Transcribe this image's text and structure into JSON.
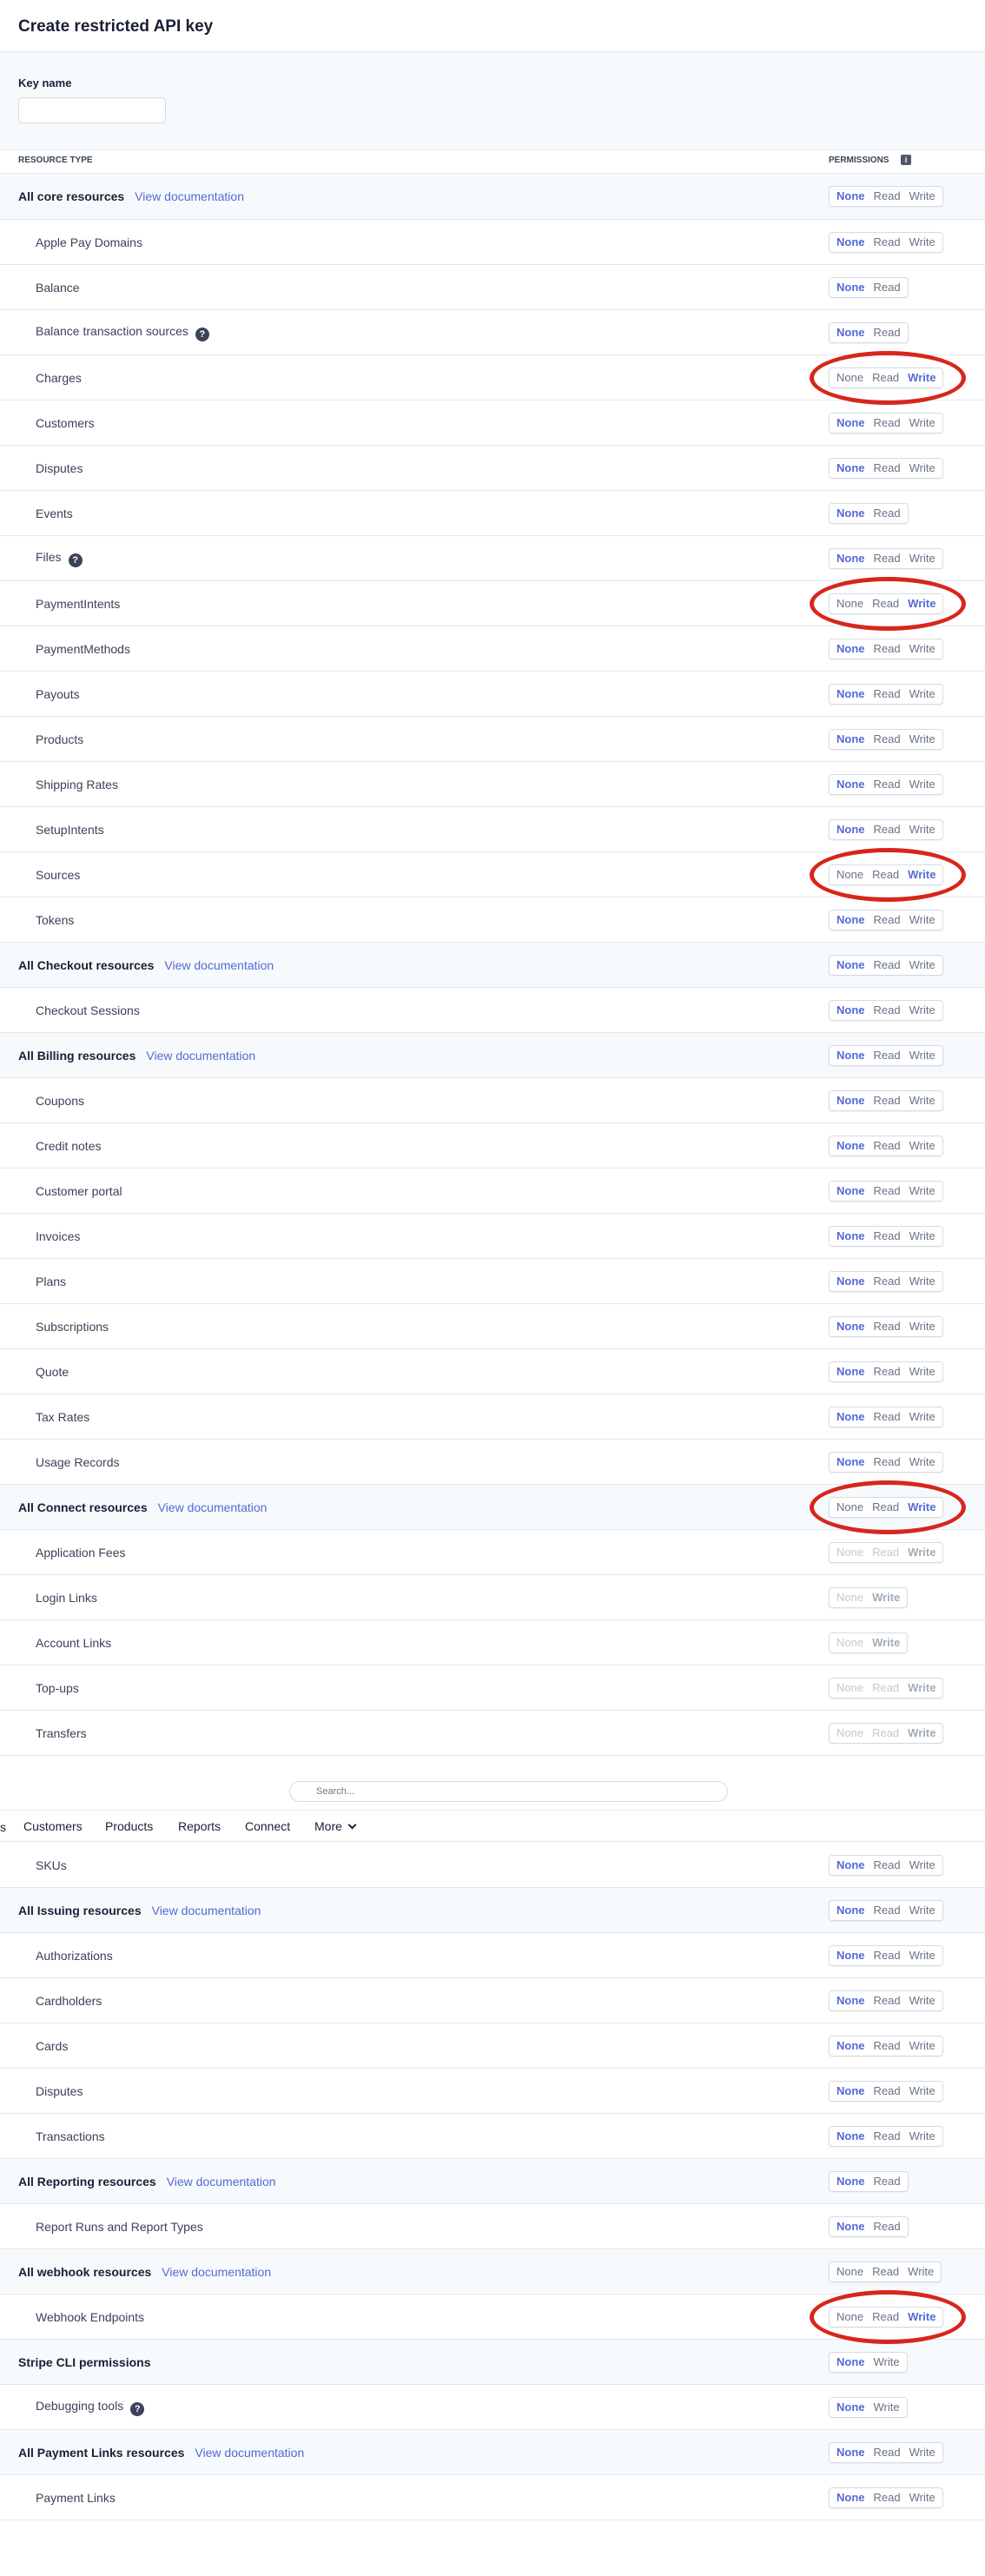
{
  "page": {
    "title": "Create restricted API key",
    "key_name_label": "Key name",
    "key_name_value": "",
    "col_resource": "RESOURCE TYPE",
    "col_permissions": "PERMISSIONS",
    "info_glyph": "i"
  },
  "options": {
    "none": "None",
    "read": "Read",
    "write": "Write"
  },
  "rows": [
    {
      "name": "All core resources",
      "type": "parent",
      "doc": "View documentation",
      "opts": [
        "none",
        "read",
        "write"
      ],
      "sel": "none"
    },
    {
      "name": "Apple Pay Domains",
      "type": "child",
      "opts": [
        "none",
        "read",
        "write"
      ],
      "sel": "none"
    },
    {
      "name": "Balance",
      "type": "child",
      "opts": [
        "none",
        "read"
      ],
      "sel": "none"
    },
    {
      "name": "Balance transaction sources",
      "type": "child",
      "help": true,
      "opts": [
        "none",
        "read"
      ],
      "sel": "none"
    },
    {
      "name": "Charges",
      "type": "child",
      "opts": [
        "none",
        "read",
        "write"
      ],
      "sel": "write",
      "circled": true
    },
    {
      "name": "Customers",
      "type": "child",
      "opts": [
        "none",
        "read",
        "write"
      ],
      "sel": "none"
    },
    {
      "name": "Disputes",
      "type": "child",
      "opts": [
        "none",
        "read",
        "write"
      ],
      "sel": "none"
    },
    {
      "name": "Events",
      "type": "child",
      "opts": [
        "none",
        "read"
      ],
      "sel": "none"
    },
    {
      "name": "Files",
      "type": "child",
      "help": true,
      "opts": [
        "none",
        "read",
        "write"
      ],
      "sel": "none"
    },
    {
      "name": "PaymentIntents",
      "type": "child",
      "opts": [
        "none",
        "read",
        "write"
      ],
      "sel": "write",
      "circled": true
    },
    {
      "name": "PaymentMethods",
      "type": "child",
      "opts": [
        "none",
        "read",
        "write"
      ],
      "sel": "none"
    },
    {
      "name": "Payouts",
      "type": "child",
      "opts": [
        "none",
        "read",
        "write"
      ],
      "sel": "none"
    },
    {
      "name": "Products",
      "type": "child",
      "opts": [
        "none",
        "read",
        "write"
      ],
      "sel": "none"
    },
    {
      "name": "Shipping Rates",
      "type": "child",
      "opts": [
        "none",
        "read",
        "write"
      ],
      "sel": "none"
    },
    {
      "name": "SetupIntents",
      "type": "child",
      "opts": [
        "none",
        "read",
        "write"
      ],
      "sel": "none"
    },
    {
      "name": "Sources",
      "type": "child",
      "opts": [
        "none",
        "read",
        "write"
      ],
      "sel": "write",
      "circled": true
    },
    {
      "name": "Tokens",
      "type": "child",
      "opts": [
        "none",
        "read",
        "write"
      ],
      "sel": "none"
    },
    {
      "name": "All Checkout resources",
      "type": "parent",
      "doc": "View documentation",
      "opts": [
        "none",
        "read",
        "write"
      ],
      "sel": "none"
    },
    {
      "name": "Checkout Sessions",
      "type": "child",
      "opts": [
        "none",
        "read",
        "write"
      ],
      "sel": "none"
    },
    {
      "name": "All Billing resources",
      "type": "parent",
      "doc": "View documentation",
      "opts": [
        "none",
        "read",
        "write"
      ],
      "sel": "none"
    },
    {
      "name": "Coupons",
      "type": "child",
      "opts": [
        "none",
        "read",
        "write"
      ],
      "sel": "none"
    },
    {
      "name": "Credit notes",
      "type": "child",
      "opts": [
        "none",
        "read",
        "write"
      ],
      "sel": "none"
    },
    {
      "name": "Customer portal",
      "type": "child",
      "opts": [
        "none",
        "read",
        "write"
      ],
      "sel": "none"
    },
    {
      "name": "Invoices",
      "type": "child",
      "opts": [
        "none",
        "read",
        "write"
      ],
      "sel": "none"
    },
    {
      "name": "Plans",
      "type": "child",
      "opts": [
        "none",
        "read",
        "write"
      ],
      "sel": "none"
    },
    {
      "name": "Subscriptions",
      "type": "child",
      "opts": [
        "none",
        "read",
        "write"
      ],
      "sel": "none"
    },
    {
      "name": "Quote",
      "type": "child",
      "opts": [
        "none",
        "read",
        "write"
      ],
      "sel": "none"
    },
    {
      "name": "Tax Rates",
      "type": "child",
      "opts": [
        "none",
        "read",
        "write"
      ],
      "sel": "none"
    },
    {
      "name": "Usage Records",
      "type": "child",
      "opts": [
        "none",
        "read",
        "write"
      ],
      "sel": "none"
    },
    {
      "name": "All Connect resources",
      "type": "parent",
      "doc": "View documentation",
      "opts": [
        "none",
        "read",
        "write"
      ],
      "sel": "write",
      "circled": true
    },
    {
      "name": "Application Fees",
      "type": "child",
      "opts": [
        "none",
        "read",
        "write"
      ],
      "sel": "write",
      "disabled": true
    },
    {
      "name": "Login Links",
      "type": "child",
      "opts": [
        "none",
        "write"
      ],
      "sel": "write",
      "disabled": true
    },
    {
      "name": "Account Links",
      "type": "child",
      "opts": [
        "none",
        "write"
      ],
      "sel": "write",
      "disabled": true
    },
    {
      "name": "Top-ups",
      "type": "child",
      "opts": [
        "none",
        "read",
        "write"
      ],
      "sel": "write",
      "disabled": true
    },
    {
      "name": "Transfers",
      "type": "child",
      "opts": [
        "none",
        "read",
        "write"
      ],
      "sel": "write",
      "disabled": true
    }
  ],
  "nav": {
    "search_placeholder": "Search...",
    "cut_item": "s",
    "items": [
      "Customers",
      "Products",
      "Reports",
      "Connect",
      "More"
    ]
  },
  "rows2": [
    {
      "name": "SKUs",
      "type": "child",
      "opts": [
        "none",
        "read",
        "write"
      ],
      "sel": "none"
    },
    {
      "name": "All Issuing resources",
      "type": "parent",
      "doc": "View documentation",
      "opts": [
        "none",
        "read",
        "write"
      ],
      "sel": "none"
    },
    {
      "name": "Authorizations",
      "type": "child",
      "opts": [
        "none",
        "read",
        "write"
      ],
      "sel": "none"
    },
    {
      "name": "Cardholders",
      "type": "child",
      "opts": [
        "none",
        "read",
        "write"
      ],
      "sel": "none"
    },
    {
      "name": "Cards",
      "type": "child",
      "opts": [
        "none",
        "read",
        "write"
      ],
      "sel": "none"
    },
    {
      "name": "Disputes",
      "type": "child",
      "opts": [
        "none",
        "read",
        "write"
      ],
      "sel": "none"
    },
    {
      "name": "Transactions",
      "type": "child",
      "opts": [
        "none",
        "read",
        "write"
      ],
      "sel": "none"
    },
    {
      "name": "All Reporting resources",
      "type": "parent",
      "doc": "View documentation",
      "opts": [
        "none",
        "read"
      ],
      "sel": "none"
    },
    {
      "name": "Report Runs and Report Types",
      "type": "child",
      "opts": [
        "none",
        "read"
      ],
      "sel": "none"
    },
    {
      "name": "All webhook resources",
      "type": "parent",
      "doc": "View documentation",
      "opts": [
        "none",
        "read",
        "write"
      ],
      "sel": "mixed"
    },
    {
      "name": "Webhook Endpoints",
      "type": "child",
      "opts": [
        "none",
        "read",
        "write"
      ],
      "sel": "write",
      "circled": true
    },
    {
      "name": "Stripe CLI permissions",
      "type": "parent",
      "opts": [
        "none",
        "write"
      ],
      "sel": "none"
    },
    {
      "name": "Debugging tools",
      "type": "child",
      "help": true,
      "opts": [
        "none",
        "write"
      ],
      "sel": "none"
    },
    {
      "name": "All Payment Links resources",
      "type": "parent",
      "doc": "View documentation",
      "opts": [
        "none",
        "read",
        "write"
      ],
      "sel": "none"
    },
    {
      "name": "Payment Links",
      "type": "child",
      "opts": [
        "none",
        "read",
        "write"
      ],
      "sel": "none"
    }
  ]
}
